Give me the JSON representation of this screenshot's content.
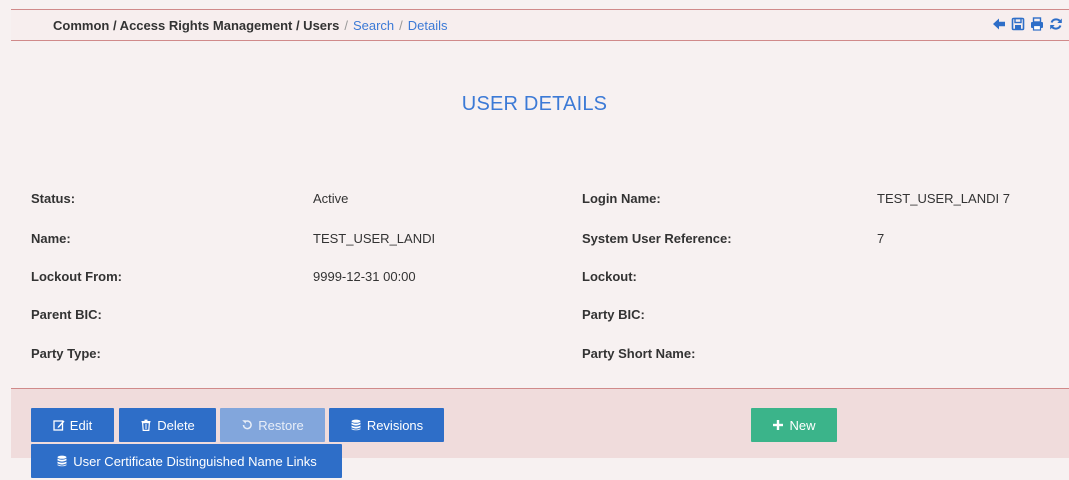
{
  "breadcrumb": {
    "path": "Common / Access Rights Management / Users",
    "sep": "/",
    "search": "Search",
    "details": "Details"
  },
  "toolbar_icons": [
    "back-arrow-icon",
    "save-icon",
    "print-icon",
    "refresh-icon"
  ],
  "colors": {
    "accent": "#3c7ad6",
    "button_blue": "#2e6ec8",
    "button_disabled": "#82a6dc",
    "button_green": "#3bb48a",
    "border": "#d08a8a",
    "background": "#f7f1f1",
    "action_bar": "#f0dcdc"
  },
  "page_title": "USER DETAILS",
  "fields": {
    "status": {
      "label": "Status:",
      "value": "Active"
    },
    "name": {
      "label": "Name:",
      "value": "TEST_USER_LANDI"
    },
    "lockout_from": {
      "label": "Lockout From:",
      "value": "9999-12-31 00:00"
    },
    "parent_bic": {
      "label": "Parent BIC:",
      "value": ""
    },
    "party_type": {
      "label": "Party Type:",
      "value": ""
    },
    "login_name": {
      "label": "Login Name:",
      "value": "TEST_USER_LANDI 7"
    },
    "system_user_reference": {
      "label": "System User Reference:",
      "value": "7"
    },
    "lockout": {
      "label": "Lockout:",
      "value": ""
    },
    "party_bic": {
      "label": "Party BIC:",
      "value": ""
    },
    "party_short_name": {
      "label": "Party Short Name:",
      "value": ""
    }
  },
  "buttons": {
    "edit": "Edit",
    "delete": "Delete",
    "restore": "Restore",
    "revisions": "Revisions",
    "new": "New",
    "cert_links": "User Certificate Distinguished Name Links"
  }
}
